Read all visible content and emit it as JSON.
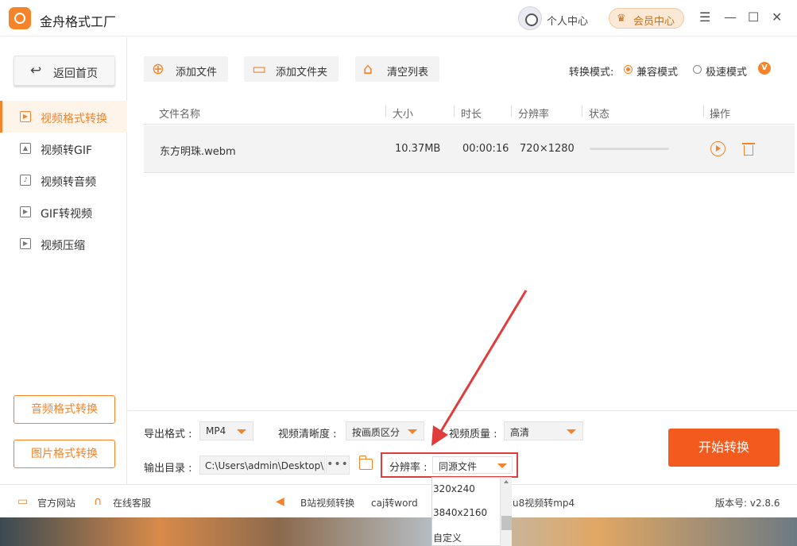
{
  "app": {
    "title": "金舟格式工厂",
    "personal_center": "个人中心",
    "member_center": "会员中心"
  },
  "window_controls": {
    "menu": "☰",
    "minimize": "—",
    "maximize": "☐",
    "close": "✕"
  },
  "sidebar": {
    "back_label": "返回首页",
    "items": [
      {
        "label": "视频格式转换",
        "active": true
      },
      {
        "label": "视频转GIF",
        "active": false
      },
      {
        "label": "视频转音频",
        "active": false
      },
      {
        "label": "GIF转视频",
        "active": false
      },
      {
        "label": "视频压缩",
        "active": false
      }
    ],
    "audio_convert": "音频格式转换",
    "image_convert": "图片格式转换"
  },
  "toolbar": {
    "add_file": "添加文件",
    "add_folder": "添加文件夹",
    "clear_list": "清空列表",
    "mode_label": "转换模式:",
    "mode_compatible": "兼容模式",
    "mode_fast": "极速模式",
    "vip_badge": "V"
  },
  "table": {
    "headers": {
      "name": "文件名称",
      "size": "大小",
      "duration": "时长",
      "resolution": "分辨率",
      "status": "状态",
      "action": "操作"
    },
    "rows": [
      {
        "name": "东方明珠.webm",
        "size": "10.37MB",
        "duration": "00:00:16",
        "resolution": "720×1280",
        "progress": 0
      }
    ]
  },
  "settings": {
    "format_label": "导出格式 :",
    "format_value": "MP4",
    "clarity_label": "视频清晰度 :",
    "clarity_value": "按画质区分",
    "quality_label": "视频质量 :",
    "quality_value": "高清",
    "output_label": "输出目录 :",
    "output_path": "C:\\Users\\admin\\Desktop\\",
    "resolution_label": "分辨率 :",
    "resolution_value": "同源文件",
    "dots": "•••",
    "start_button": "开始转换"
  },
  "dropdown": {
    "options": [
      "320x240",
      "3840x2160",
      "自定义"
    ]
  },
  "statusbar": {
    "website": "官方网站",
    "support": "在线客服",
    "promo1": "B站视频转换",
    "promo2": "caj转word",
    "promo3": "u8视频转mp4",
    "version": "版本号: v2.8.6"
  },
  "colors": {
    "accent": "#f5832a",
    "start": "#f35a1d",
    "highlight": "#e03c3c"
  }
}
